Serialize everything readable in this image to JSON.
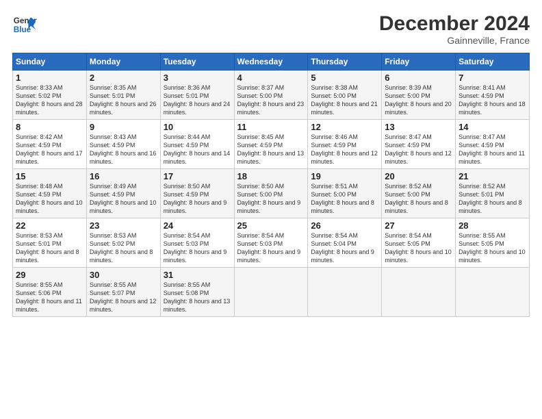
{
  "header": {
    "logo_line1": "General",
    "logo_line2": "Blue",
    "month": "December 2024",
    "location": "Gainneville, France"
  },
  "weekdays": [
    "Sunday",
    "Monday",
    "Tuesday",
    "Wednesday",
    "Thursday",
    "Friday",
    "Saturday"
  ],
  "weeks": [
    [
      {
        "day": "1",
        "sunrise": "Sunrise: 8:33 AM",
        "sunset": "Sunset: 5:02 PM",
        "daylight": "Daylight: 8 hours and 28 minutes."
      },
      {
        "day": "2",
        "sunrise": "Sunrise: 8:35 AM",
        "sunset": "Sunset: 5:01 PM",
        "daylight": "Daylight: 8 hours and 26 minutes."
      },
      {
        "day": "3",
        "sunrise": "Sunrise: 8:36 AM",
        "sunset": "Sunset: 5:01 PM",
        "daylight": "Daylight: 8 hours and 24 minutes."
      },
      {
        "day": "4",
        "sunrise": "Sunrise: 8:37 AM",
        "sunset": "Sunset: 5:00 PM",
        "daylight": "Daylight: 8 hours and 23 minutes."
      },
      {
        "day": "5",
        "sunrise": "Sunrise: 8:38 AM",
        "sunset": "Sunset: 5:00 PM",
        "daylight": "Daylight: 8 hours and 21 minutes."
      },
      {
        "day": "6",
        "sunrise": "Sunrise: 8:39 AM",
        "sunset": "Sunset: 5:00 PM",
        "daylight": "Daylight: 8 hours and 20 minutes."
      },
      {
        "day": "7",
        "sunrise": "Sunrise: 8:41 AM",
        "sunset": "Sunset: 4:59 PM",
        "daylight": "Daylight: 8 hours and 18 minutes."
      }
    ],
    [
      {
        "day": "8",
        "sunrise": "Sunrise: 8:42 AM",
        "sunset": "Sunset: 4:59 PM",
        "daylight": "Daylight: 8 hours and 17 minutes."
      },
      {
        "day": "9",
        "sunrise": "Sunrise: 8:43 AM",
        "sunset": "Sunset: 4:59 PM",
        "daylight": "Daylight: 8 hours and 16 minutes."
      },
      {
        "day": "10",
        "sunrise": "Sunrise: 8:44 AM",
        "sunset": "Sunset: 4:59 PM",
        "daylight": "Daylight: 8 hours and 14 minutes."
      },
      {
        "day": "11",
        "sunrise": "Sunrise: 8:45 AM",
        "sunset": "Sunset: 4:59 PM",
        "daylight": "Daylight: 8 hours and 13 minutes."
      },
      {
        "day": "12",
        "sunrise": "Sunrise: 8:46 AM",
        "sunset": "Sunset: 4:59 PM",
        "daylight": "Daylight: 8 hours and 12 minutes."
      },
      {
        "day": "13",
        "sunrise": "Sunrise: 8:47 AM",
        "sunset": "Sunset: 4:59 PM",
        "daylight": "Daylight: 8 hours and 12 minutes."
      },
      {
        "day": "14",
        "sunrise": "Sunrise: 8:47 AM",
        "sunset": "Sunset: 4:59 PM",
        "daylight": "Daylight: 8 hours and 11 minutes."
      }
    ],
    [
      {
        "day": "15",
        "sunrise": "Sunrise: 8:48 AM",
        "sunset": "Sunset: 4:59 PM",
        "daylight": "Daylight: 8 hours and 10 minutes."
      },
      {
        "day": "16",
        "sunrise": "Sunrise: 8:49 AM",
        "sunset": "Sunset: 4:59 PM",
        "daylight": "Daylight: 8 hours and 10 minutes."
      },
      {
        "day": "17",
        "sunrise": "Sunrise: 8:50 AM",
        "sunset": "Sunset: 4:59 PM",
        "daylight": "Daylight: 8 hours and 9 minutes."
      },
      {
        "day": "18",
        "sunrise": "Sunrise: 8:50 AM",
        "sunset": "Sunset: 5:00 PM",
        "daylight": "Daylight: 8 hours and 9 minutes."
      },
      {
        "day": "19",
        "sunrise": "Sunrise: 8:51 AM",
        "sunset": "Sunset: 5:00 PM",
        "daylight": "Daylight: 8 hours and 8 minutes."
      },
      {
        "day": "20",
        "sunrise": "Sunrise: 8:52 AM",
        "sunset": "Sunset: 5:00 PM",
        "daylight": "Daylight: 8 hours and 8 minutes."
      },
      {
        "day": "21",
        "sunrise": "Sunrise: 8:52 AM",
        "sunset": "Sunset: 5:01 PM",
        "daylight": "Daylight: 8 hours and 8 minutes."
      }
    ],
    [
      {
        "day": "22",
        "sunrise": "Sunrise: 8:53 AM",
        "sunset": "Sunset: 5:01 PM",
        "daylight": "Daylight: 8 hours and 8 minutes."
      },
      {
        "day": "23",
        "sunrise": "Sunrise: 8:53 AM",
        "sunset": "Sunset: 5:02 PM",
        "daylight": "Daylight: 8 hours and 8 minutes."
      },
      {
        "day": "24",
        "sunrise": "Sunrise: 8:54 AM",
        "sunset": "Sunset: 5:03 PM",
        "daylight": "Daylight: 8 hours and 9 minutes."
      },
      {
        "day": "25",
        "sunrise": "Sunrise: 8:54 AM",
        "sunset": "Sunset: 5:03 PM",
        "daylight": "Daylight: 8 hours and 9 minutes."
      },
      {
        "day": "26",
        "sunrise": "Sunrise: 8:54 AM",
        "sunset": "Sunset: 5:04 PM",
        "daylight": "Daylight: 8 hours and 9 minutes."
      },
      {
        "day": "27",
        "sunrise": "Sunrise: 8:54 AM",
        "sunset": "Sunset: 5:05 PM",
        "daylight": "Daylight: 8 hours and 10 minutes."
      },
      {
        "day": "28",
        "sunrise": "Sunrise: 8:55 AM",
        "sunset": "Sunset: 5:05 PM",
        "daylight": "Daylight: 8 hours and 10 minutes."
      }
    ],
    [
      {
        "day": "29",
        "sunrise": "Sunrise: 8:55 AM",
        "sunset": "Sunset: 5:06 PM",
        "daylight": "Daylight: 8 hours and 11 minutes."
      },
      {
        "day": "30",
        "sunrise": "Sunrise: 8:55 AM",
        "sunset": "Sunset: 5:07 PM",
        "daylight": "Daylight: 8 hours and 12 minutes."
      },
      {
        "day": "31",
        "sunrise": "Sunrise: 8:55 AM",
        "sunset": "Sunset: 5:08 PM",
        "daylight": "Daylight: 8 hours and 13 minutes."
      },
      null,
      null,
      null,
      null
    ]
  ]
}
